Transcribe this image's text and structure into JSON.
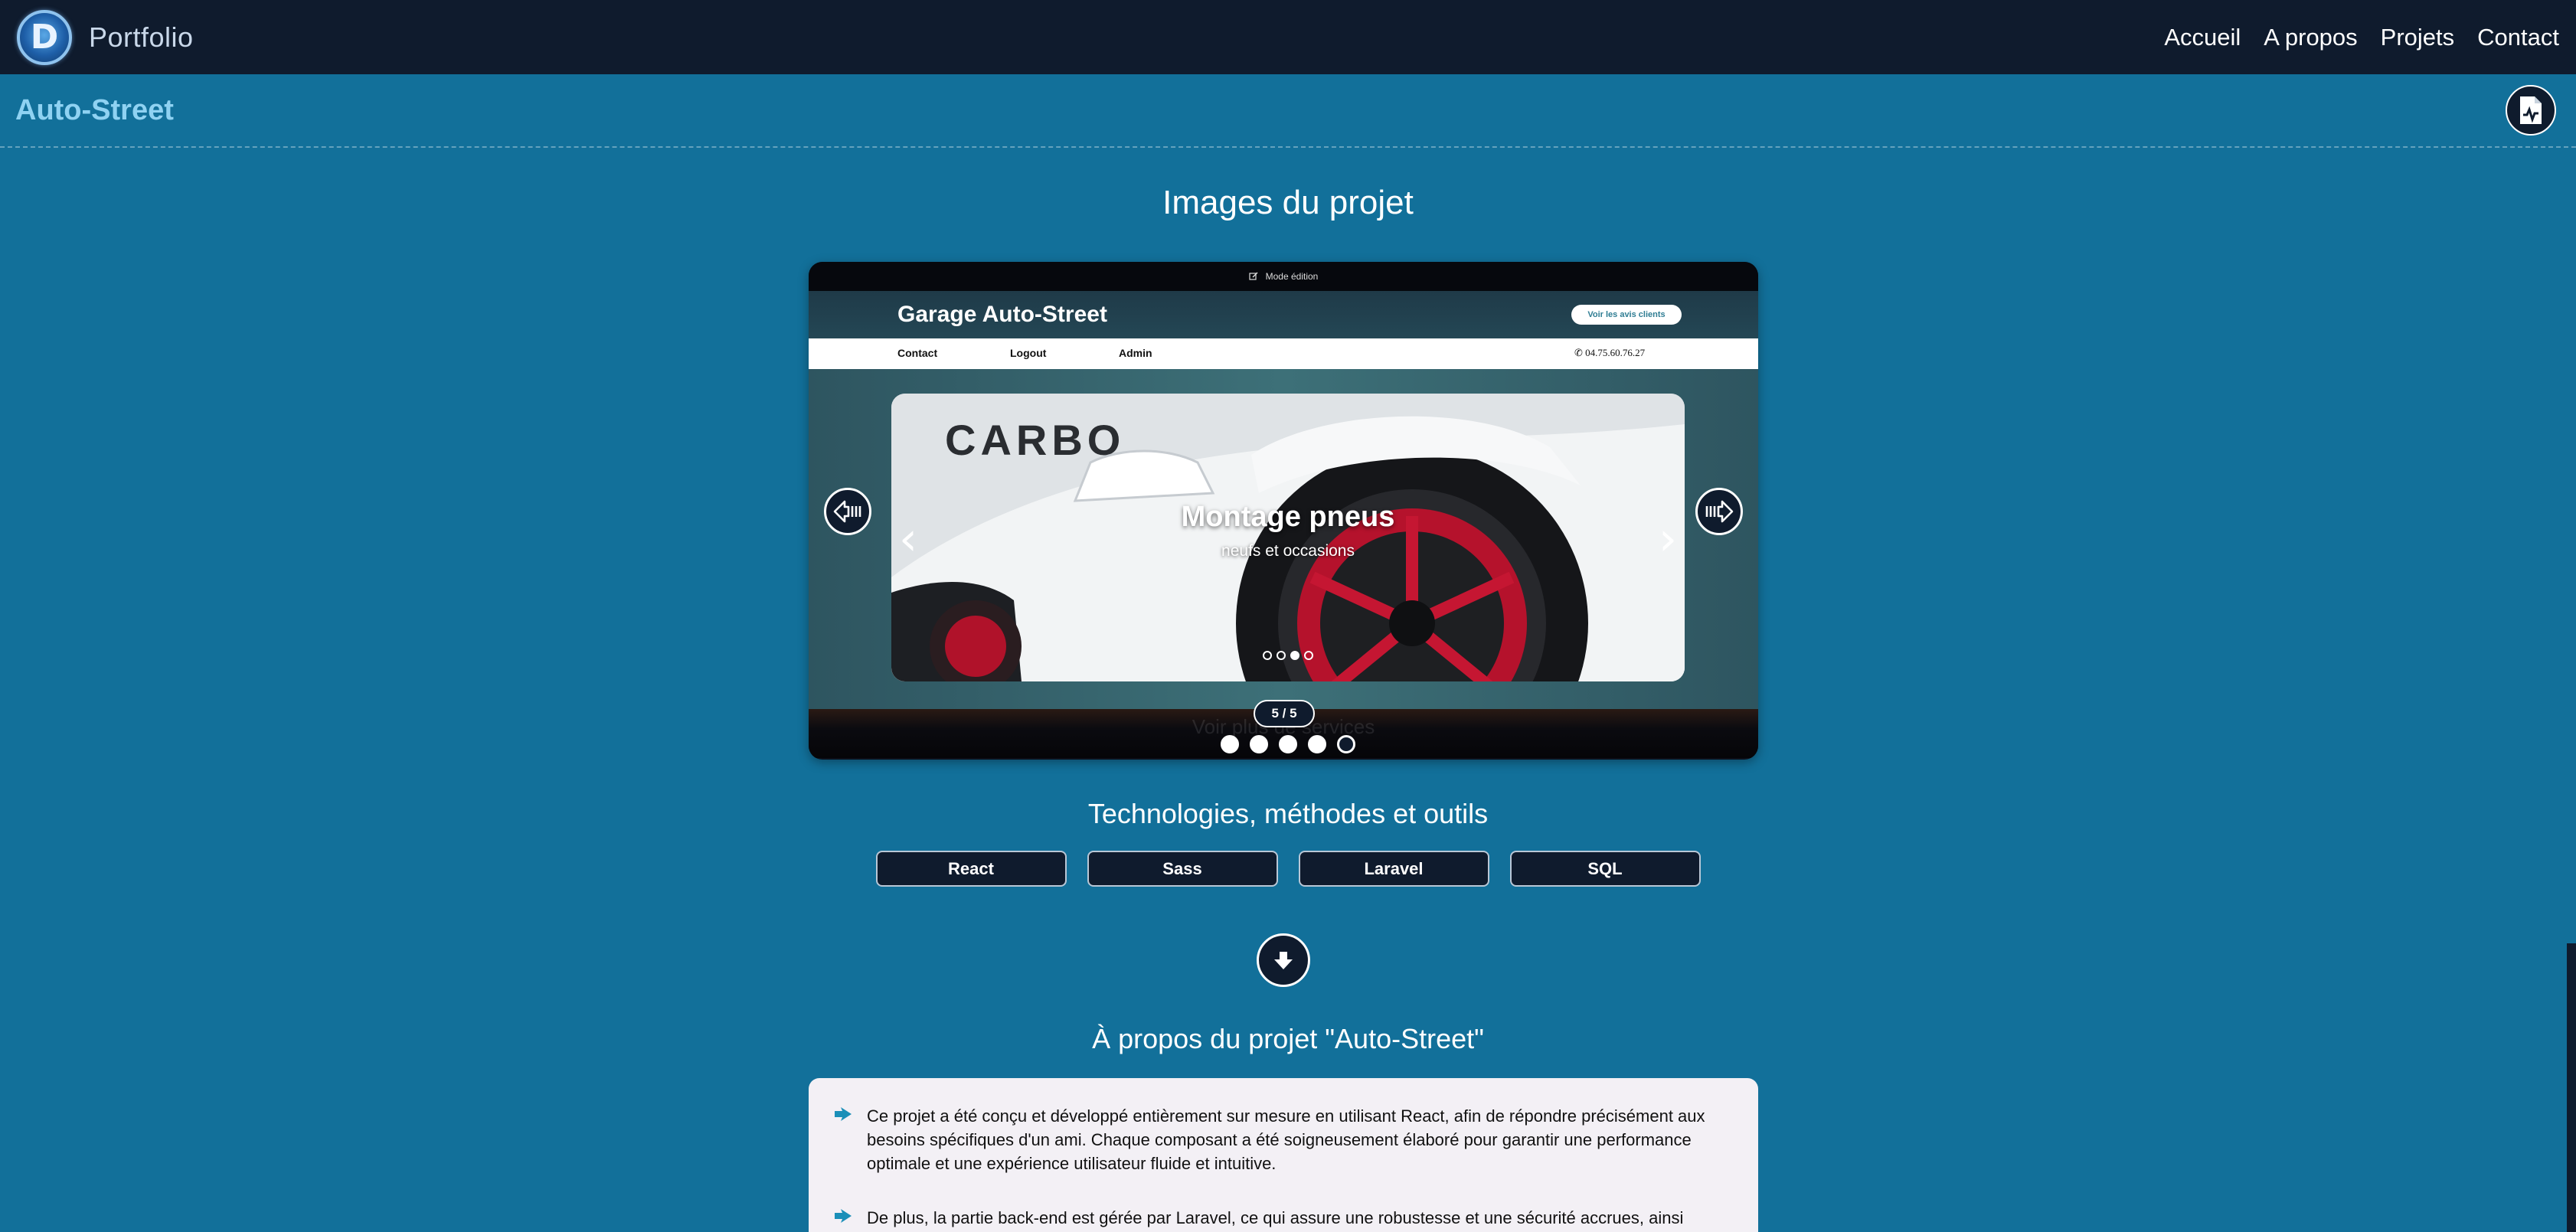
{
  "nav": {
    "logo_letter": "D",
    "brand": "Portfolio",
    "links": [
      "Accueil",
      "A propos",
      "Projets",
      "Contact"
    ]
  },
  "header": {
    "title": "Auto-Street"
  },
  "gallery": {
    "title": "Images du projet",
    "counter": "5 / 5",
    "dots_total": 5,
    "active_dot": 5,
    "screenshot": {
      "topbar": "Mode édition",
      "site_title": "Garage Auto-Street",
      "reviews_button": "Voir les avis clients",
      "menu": [
        "Contact",
        "Logout",
        "Admin"
      ],
      "phone": "04.75.60.76.27",
      "slide_title": "Montage pneus",
      "slide_subtitle": "neufs et occasions",
      "photo_text": "CARBO",
      "faded_text": "Voir plus de services"
    }
  },
  "tech": {
    "title": "Technologies, méthodes et outils",
    "items": [
      "React",
      "Sass",
      "Laravel",
      "SQL"
    ]
  },
  "about": {
    "title": "À propos du projet \"Auto-Street\"",
    "paragraphs": [
      "Ce projet a été conçu et développé entièrement sur mesure en utilisant React, afin de répondre précisément aux besoins spécifiques d'un ami. Chaque composant a été soigneusement élaboré pour garantir une performance optimale et une expérience utilisateur fluide et intuitive.",
      "De plus, la partie back-end est gérée par Laravel, ce qui assure une robustesse et une sécurité accrues, ainsi"
    ]
  },
  "colors": {
    "page_bg": "#12709a",
    "nav_bg": "#0f1b2d",
    "title_accent": "#8fd2f2",
    "card_bg": "#f3f0f5"
  },
  "icons": {
    "document": "file-chart-icon",
    "prev": "arrow-left-icon",
    "next": "arrow-right-icon",
    "down": "arrow-down-icon",
    "bullet": "hand-pointer-icon"
  }
}
